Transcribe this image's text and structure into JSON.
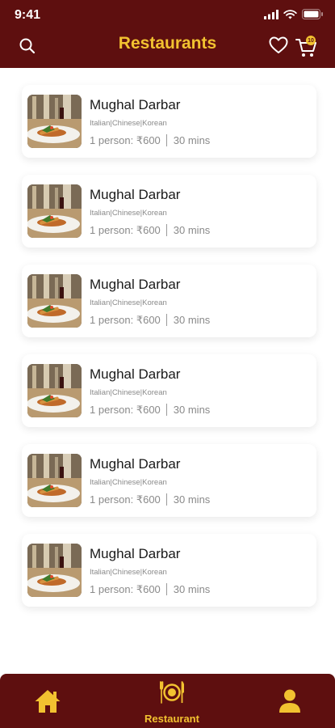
{
  "status_bar": {
    "time": "9:41"
  },
  "header": {
    "title": "Restaurants",
    "cart_count": "10"
  },
  "restaurants": [
    {
      "name": "Mughal Darbar",
      "cuisines": "Italian|Chinese|Korean",
      "price": "1 person: ₹600",
      "time": "30 mins"
    },
    {
      "name": "Mughal Darbar",
      "cuisines": "Italian|Chinese|Korean",
      "price": "1 person: ₹600",
      "time": "30 mins"
    },
    {
      "name": "Mughal Darbar",
      "cuisines": "Italian|Chinese|Korean",
      "price": "1 person: ₹600",
      "time": "30 mins"
    },
    {
      "name": "Mughal Darbar",
      "cuisines": "Italian|Chinese|Korean",
      "price": "1 person: ₹600",
      "time": "30 mins"
    },
    {
      "name": "Mughal Darbar",
      "cuisines": "Italian|Chinese|Korean",
      "price": "1 person: ₹600",
      "time": "30 mins"
    },
    {
      "name": "Mughal Darbar",
      "cuisines": "Italian|Chinese|Korean",
      "price": "1 person: ₹600",
      "time": "30 mins"
    }
  ],
  "bottom_nav": {
    "items": [
      {
        "label": "",
        "icon": "home-icon"
      },
      {
        "label": "Restaurant",
        "icon": "dining-icon",
        "active": true
      },
      {
        "label": "",
        "icon": "profile-icon"
      }
    ]
  },
  "colors": {
    "brand": "#5e0f0f",
    "accent": "#f2c230",
    "muted_text": "#8a8a8a"
  }
}
